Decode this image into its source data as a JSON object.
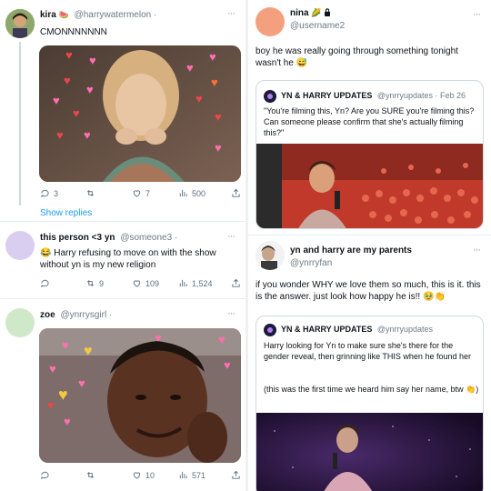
{
  "colors": {
    "link": "#1d9bf0",
    "muted": "#5b7083",
    "border": "#cfd9de"
  },
  "left": {
    "tweet1": {
      "name": "kira",
      "name_emoji": "🍉",
      "handle": "@harrywatermelon ·",
      "text": "CMONNNNNNN",
      "reply_count": "3",
      "retweet_count": "",
      "like_count": "7",
      "views_count": "500",
      "show_replies": "Show replies"
    },
    "tweet2": {
      "name": "this person <3 yn",
      "handle": "@someone3 ·",
      "text": "😂 Harry refusing to move on with the show without yn is my new religion",
      "reply_count": "",
      "retweet_count": "9",
      "like_count": "109",
      "views_count": "1,524"
    },
    "tweet3": {
      "name": "zoe",
      "handle": "@ynrrysgirl ·",
      "reply_count": "",
      "retweet_count": "",
      "like_count": "10",
      "views_count": "571"
    }
  },
  "right": {
    "tweet1": {
      "name": "nina",
      "name_emoji": "🌽",
      "lock_icon": "lock-icon",
      "handle": "@username2",
      "text": "boy he was really going through something tonight wasn't he 😅",
      "quote": {
        "name": "YN & HARRY UPDATES",
        "handle": "@ynrryupdates · Feb 26",
        "text": "\"You're filming this, Yn? Are you SURE you're filming this? Can someone please confirm that she's actually filming this?\""
      }
    },
    "tweet2": {
      "name": "yn and harry are my parents",
      "handle": "@ynrryfan",
      "text": "if you wonder WHY we love them so much, this is it. this is the answer. just look how happy he is!! 🥹👏",
      "quote": {
        "name": "YN & HARRY UPDATES",
        "handle": "@ynrryupdates",
        "text": "Harry looking for Yn to make sure she's there for the gender reveal, then grinning like THIS when he found her",
        "text2": "(this was the first time we heard him say her name, btw 👏)"
      }
    }
  },
  "icons": {
    "reply": "reply-icon",
    "retweet": "retweet-icon",
    "like": "heart-icon",
    "views": "views-icon",
    "share": "share-icon",
    "more": "more-icon"
  }
}
